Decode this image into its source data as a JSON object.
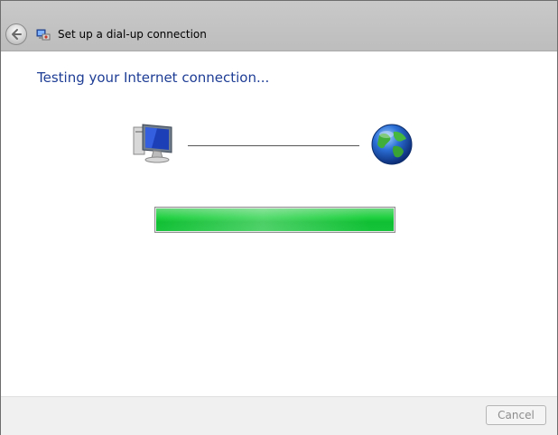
{
  "window": {
    "title": "Set up a dial-up connection"
  },
  "main": {
    "heading": "Testing your Internet connection...",
    "progress": {
      "value_percent": 100,
      "color": "#1fd140"
    }
  },
  "icons": {
    "back": "back-arrow-icon",
    "title": "network-connection-icon",
    "computer": "computer-monitor-icon",
    "internet": "globe-icon"
  },
  "footer": {
    "cancel_label": "Cancel"
  },
  "colors": {
    "heading": "#1e3d95",
    "titlebar": "#c4c4c4",
    "footer": "#f0f0f0"
  }
}
